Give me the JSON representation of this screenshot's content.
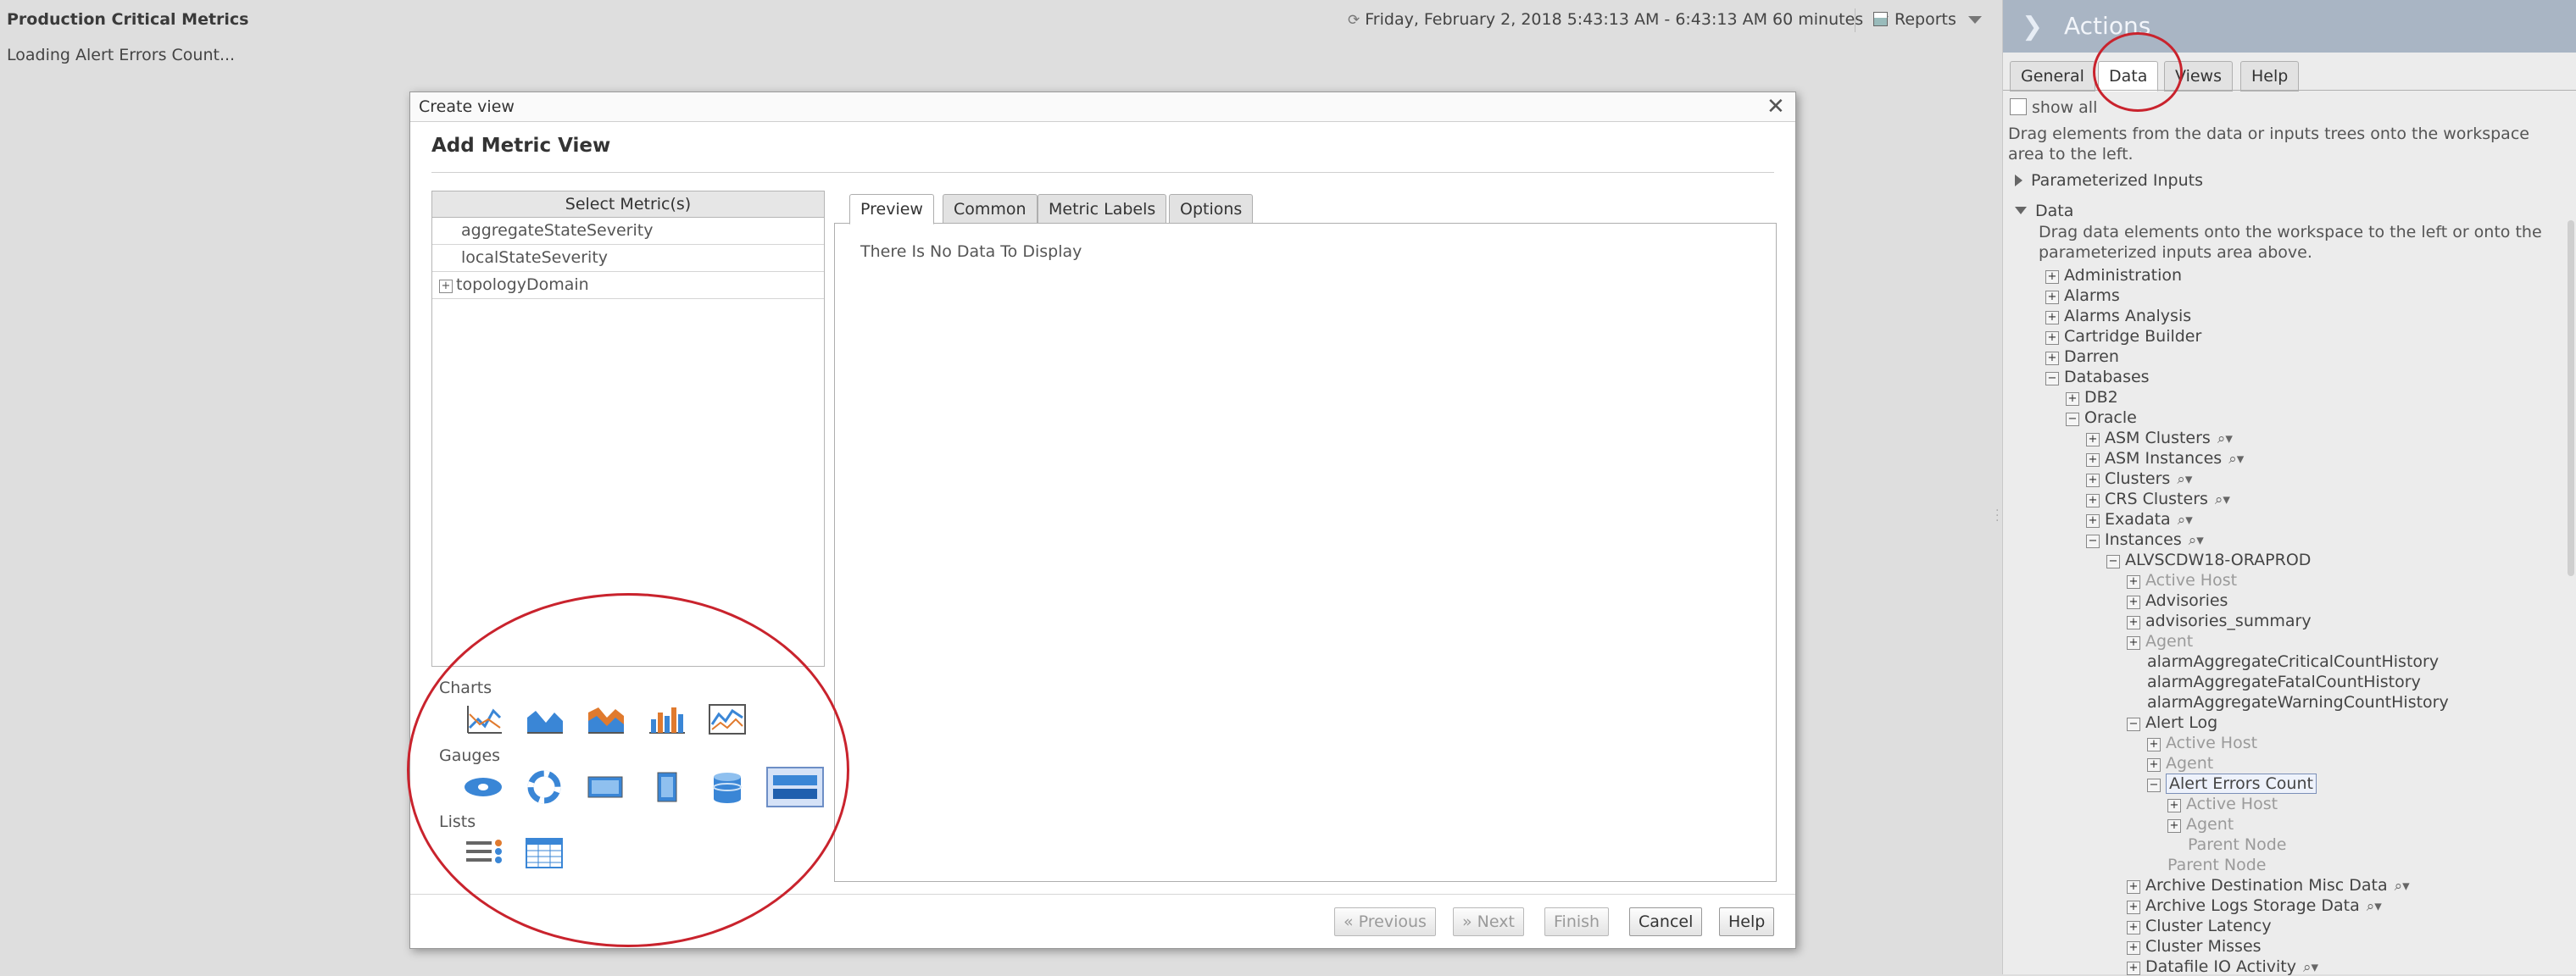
{
  "dashboard": {
    "title": "Production Critical Metrics",
    "loading_text": "Loading Alert Errors Count...",
    "time_range": "Friday, February 2, 2018 5:43:13 AM - 6:43:13 AM 60 minutes",
    "reports_label": "Reports"
  },
  "actions_panel": {
    "title": "Actions",
    "tabs": [
      {
        "label": "General",
        "active": false
      },
      {
        "label": "Data",
        "active": true
      },
      {
        "label": "Views",
        "active": false
      },
      {
        "label": "Help",
        "active": false
      }
    ],
    "show_all_label": "show all",
    "drag_help": "Drag elements from the data or inputs trees onto the workspace area to the left.",
    "parameterized_inputs": "Parameterized Inputs",
    "data_label": "Data",
    "data_help": "Drag data elements onto the workspace to the left or onto the parameterized inputs area above.",
    "tree": [
      "Administration",
      "Alarms",
      "Alarms Analysis",
      "Cartridge Builder",
      "Darren",
      "Databases",
      "DB2",
      "Oracle",
      "ASM Clusters",
      "ASM Instances",
      "Clusters",
      "CRS Clusters",
      "Exadata",
      "Instances",
      "ALVSCDW18-ORAPROD",
      "Active Host",
      "Advisories",
      "advisories_summary",
      "Agent",
      "alarmAggregateCriticalCountHistory",
      "alarmAggregateFatalCountHistory",
      "alarmAggregateWarningCountHistory",
      "Alert Log",
      "Active Host",
      "Agent",
      "Alert Errors Count",
      "Active Host",
      "Agent",
      "Parent Node",
      "Parent Node",
      "Archive Destination Misc Data",
      "Archive Logs Storage Data",
      "Cluster Latency",
      "Cluster Misses",
      "Datafile IO Activity"
    ]
  },
  "dialog": {
    "title": "Create view",
    "heading": "Add Metric View",
    "metric_header": "Select Metric(s)",
    "metrics": [
      "aggregateStateSeverity",
      "localStateSeverity",
      "topologyDomain"
    ],
    "palette": {
      "charts": "Charts",
      "gauges": "Gauges",
      "lists": "Lists"
    },
    "tabs": [
      {
        "label": "Preview",
        "active": true
      },
      {
        "label": "Common",
        "active": false
      },
      {
        "label": "Metric Labels",
        "active": false
      },
      {
        "label": "Options",
        "active": false
      }
    ],
    "no_data": "There Is No Data To Display",
    "buttons": {
      "previous": "« Previous",
      "next": "» Next",
      "finish": "Finish",
      "cancel": "Cancel",
      "help": "Help"
    }
  },
  "icons": {
    "charts": [
      "line-chart-icon",
      "area-chart-icon",
      "stacked-area-chart-icon",
      "bar-chart-icon",
      "multi-line-chart-icon"
    ],
    "gauges": [
      "ellipse-gauge-icon",
      "ring-gauge-icon",
      "horizontal-gauge-icon",
      "vertical-gauge-icon",
      "cylinder-gauge-icon",
      "bar-gauge-icon"
    ],
    "lists": [
      "list-icon",
      "table-icon"
    ]
  },
  "colors": {
    "annotation": "#c9232d",
    "panel_header": "#a9b5c4",
    "icon_blue": "#3a86d6"
  }
}
